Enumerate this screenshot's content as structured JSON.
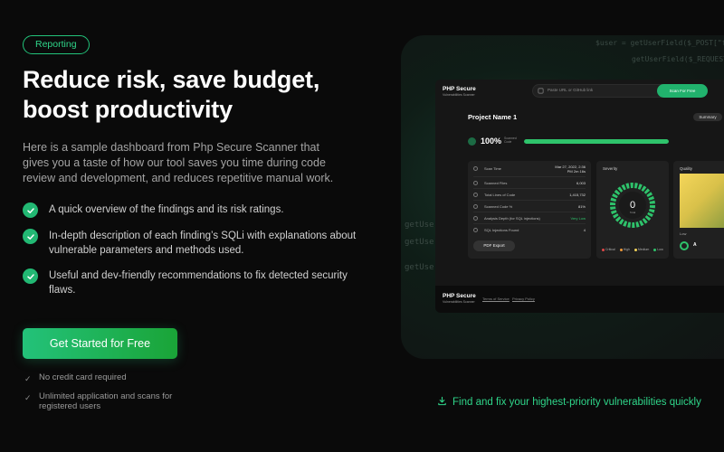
{
  "hero": {
    "badge": "Reporting",
    "headline": "Reduce risk, save budget, boost productivity",
    "intro": "Here is a sample dashboard from Php Secure Scanner that gives you a taste of how our tool saves you time during code review and development, and reduces repetitive manual work.",
    "features": [
      "A quick overview of the findings and its risk ratings.",
      "In-depth description of each finding’s SQLi with explanations about vulnerable parameters and methods used.",
      "Useful and dev-friendly recommendations to fix detected security flaws."
    ],
    "cta": "Get Started for Free",
    "notes": [
      "No credit card required",
      "Unlimited application and scans for registered users"
    ]
  },
  "showcase": {
    "code_lines": [
      "$user = getUserField($_POST[\"field\"]);",
      "getUserField($_REQUEST[\"field\"]);",
      "getUserF",
      "getUser",
      "getUser"
    ],
    "caption": "Find and fix your highest-priority vulnerabilities quickly"
  },
  "dashboard": {
    "brand_name": "PHP Secure",
    "brand_sub": "Vulnerabilities Scanner",
    "url_placeholder": "Paste URL or GitHub link",
    "scan_button": "Scan For Free",
    "project_title": "Project Name 1",
    "summary_label": "Summary",
    "score": "100%",
    "score_fraction": 1.0,
    "score_label": "Scanned Code",
    "stats": [
      {
        "label": "Scan Time",
        "value": "Mar 27, 2022, 2:36 PM 2m 16s"
      },
      {
        "label": "Scanned Files",
        "value": "6,003"
      },
      {
        "label": "Total Lines of Code",
        "value": "1,415,732"
      },
      {
        "label": "Scanned Code %",
        "value": "81%"
      },
      {
        "label": "Analysis Depth (for SQL injections)",
        "value": "Very Low"
      },
      {
        "label": "SQL Injections Found",
        "value": "4"
      }
    ],
    "pdf_export": "PDF Export",
    "severity_title": "Severity",
    "severity_total": "0",
    "severity_total_label": "Total",
    "severity_legend": [
      "Critical",
      "High",
      "Medium",
      "Low"
    ],
    "quality_title": "Quality",
    "quality_low": "Low",
    "quality_grade": "A",
    "footer_brand": "PHP Secure",
    "footer_sub": "Vulnerabilities Scanner",
    "footer_links": [
      "Terms of Service",
      "Privacy Policy"
    ]
  },
  "colors": {
    "accent": "#22c37a",
    "background": "#0a0a0a",
    "critical": "#e04848",
    "high": "#f09a3a",
    "medium": "#f2d35a",
    "low": "#2ec36b"
  },
  "icons": {
    "feature_check": "check-circle-icon",
    "note_check": "check-icon",
    "caption": "download-icon"
  }
}
